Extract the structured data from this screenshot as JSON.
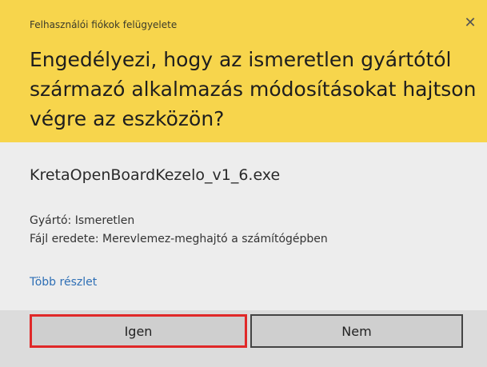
{
  "dialog": {
    "title": "Felhasználói fiókok felügyelete",
    "close_glyph": "✕",
    "question_lines": [
      "Engedélyezi, hogy az ismeretlen gyártótól",
      "származó alkalmazás módosításokat hajtson",
      "végre az eszközön?"
    ],
    "app_name": "KretaOpenBoardKezelo_v1_6.exe",
    "publisher": "Gyártó: Ismeretlen",
    "file_origin": "Fájl eredete: Merevlemez-meghajtó a számítógépben",
    "more_details": "Több részlet",
    "yes_label": "Igen",
    "no_label": "Nem"
  },
  "colors": {
    "banner": "#f7d54c",
    "link": "#2e6fb5",
    "highlight_border": "#e02828"
  }
}
